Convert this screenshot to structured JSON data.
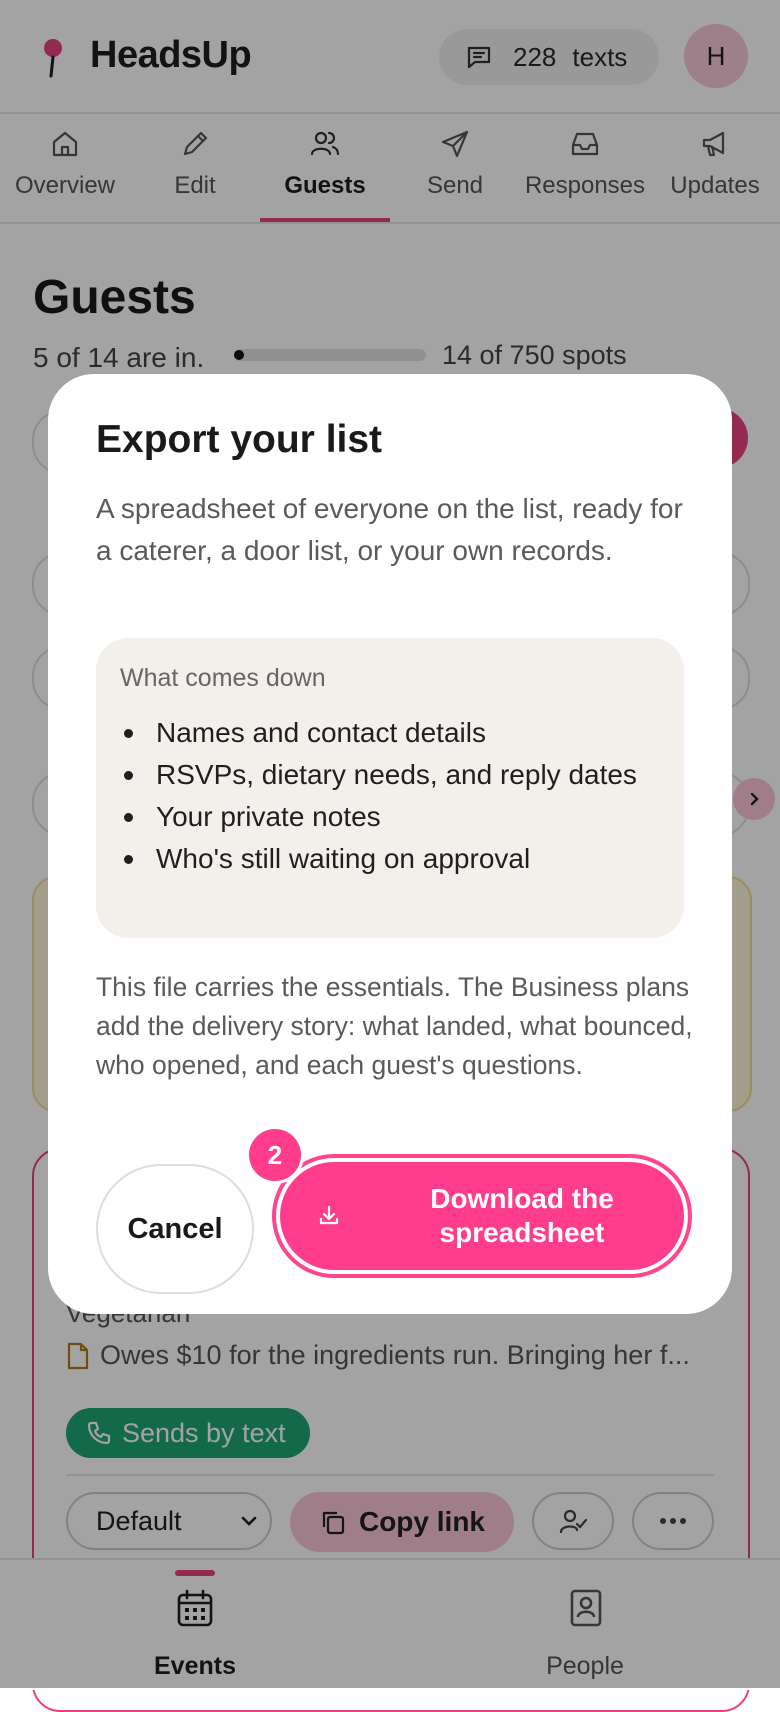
{
  "app": {
    "brand": "HeadsUp",
    "texts_count": "228",
    "texts_label": "texts",
    "avatar_initial": "H",
    "brand_color": "#e8407f"
  },
  "tabs": [
    {
      "label": "Overview",
      "icon": "home-icon"
    },
    {
      "label": "Edit",
      "icon": "pencil-icon"
    },
    {
      "label": "Guests",
      "icon": "users-icon",
      "active": true
    },
    {
      "label": "Send",
      "icon": "send-icon"
    },
    {
      "label": "Responses",
      "icon": "inbox-icon"
    },
    {
      "label": "Updates",
      "icon": "megaphone-icon"
    }
  ],
  "guests": {
    "title": "Guests",
    "status": "5 of 14 are in.",
    "spots": "14 of 750 spots",
    "progress_fraction": 0.019
  },
  "guest_card": {
    "diet": "Vegetarian",
    "note": "Owes $10 for the ingredients run. Bringing her f...",
    "channel_badge": "Sends by text",
    "channel_color": "#1fa675",
    "template_select": "Default",
    "copy_link_label": "Copy link"
  },
  "bottom_nav": [
    {
      "label": "Events",
      "icon": "calendar-icon",
      "active": true
    },
    {
      "label": "People",
      "icon": "contacts-icon"
    }
  ],
  "modal": {
    "title": "Export your list",
    "description": "A spreadsheet of everyone on the list, ready for a caterer, a door list, or your own records.",
    "box_heading": "What comes down",
    "items": [
      "Names and contact details",
      "RSVPs, dietary needs, and reply dates",
      "Your private notes",
      "Who's still waiting on approval"
    ],
    "footnote": "This file carries the essentials. The Business plans add the delivery story: what landed, what bounced, who opened, and each guest's questions.",
    "cancel_label": "Cancel",
    "download_label": "Download the spreadsheet",
    "step_badge": "2",
    "accent": "#ff3d8c"
  }
}
